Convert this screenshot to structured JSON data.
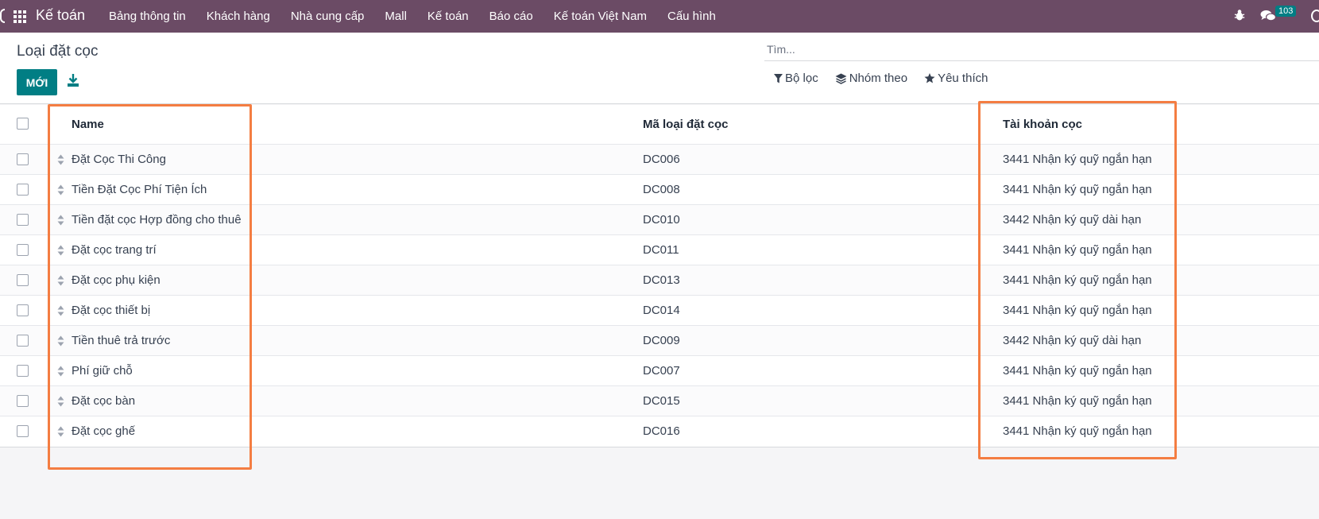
{
  "navbar": {
    "brand": "Kế toán",
    "menu": [
      "Bảng thông tin",
      "Khách hàng",
      "Nhà cung cấp",
      "Mall",
      "Kế toán",
      "Báo cáo",
      "Kế toán Việt Nam",
      "Cấu hình"
    ],
    "chat_badge": "103",
    "icons": [
      "apps-grid-icon",
      "bug-icon",
      "chat-icon"
    ]
  },
  "control": {
    "title": "Loại đặt cọc",
    "new_label": "MỚI",
    "search_placeholder": "Tìm...",
    "filter_label": "Bộ lọc",
    "group_label": "Nhóm theo",
    "favorite_label": "Yêu thích"
  },
  "table": {
    "headers": [
      "Name",
      "Mã loại đặt cọc",
      "Tài khoản cọc"
    ],
    "rows": [
      [
        "Đặt Cọc Thi Công",
        "DC006",
        "3441 Nhận ký quỹ ngắn hạn"
      ],
      [
        "Tiền Đặt Cọc Phí Tiện Ích",
        "DC008",
        "3441 Nhận ký quỹ ngắn hạn"
      ],
      [
        "Tiền đặt cọc Hợp đồng cho thuê",
        "DC010",
        "3442 Nhận ký quỹ dài hạn"
      ],
      [
        "Đặt cọc trang trí",
        "DC011",
        "3441 Nhận ký quỹ ngắn hạn"
      ],
      [
        "Đặt cọc phụ kiện",
        "DC013",
        "3441 Nhận ký quỹ ngắn hạn"
      ],
      [
        "Đặt cọc thiết bị",
        "DC014",
        "3441 Nhận ký quỹ ngắn hạn"
      ],
      [
        "Tiền thuê trả trước",
        "DC009",
        "3442 Nhận ký quỹ dài hạn"
      ],
      [
        "Phí giữ chỗ",
        "DC007",
        "3441 Nhận ký quỹ ngắn hạn"
      ],
      [
        "Đặt cọc bàn",
        "DC015",
        "3441 Nhận ký quỹ ngắn hạn"
      ],
      [
        "Đặt cọc ghế",
        "DC016",
        "3441 Nhận ký quỹ ngắn hạn"
      ]
    ]
  },
  "colors": {
    "navbar": "#6b4b65",
    "primary": "#017e84",
    "highlight": "#f47d42"
  }
}
